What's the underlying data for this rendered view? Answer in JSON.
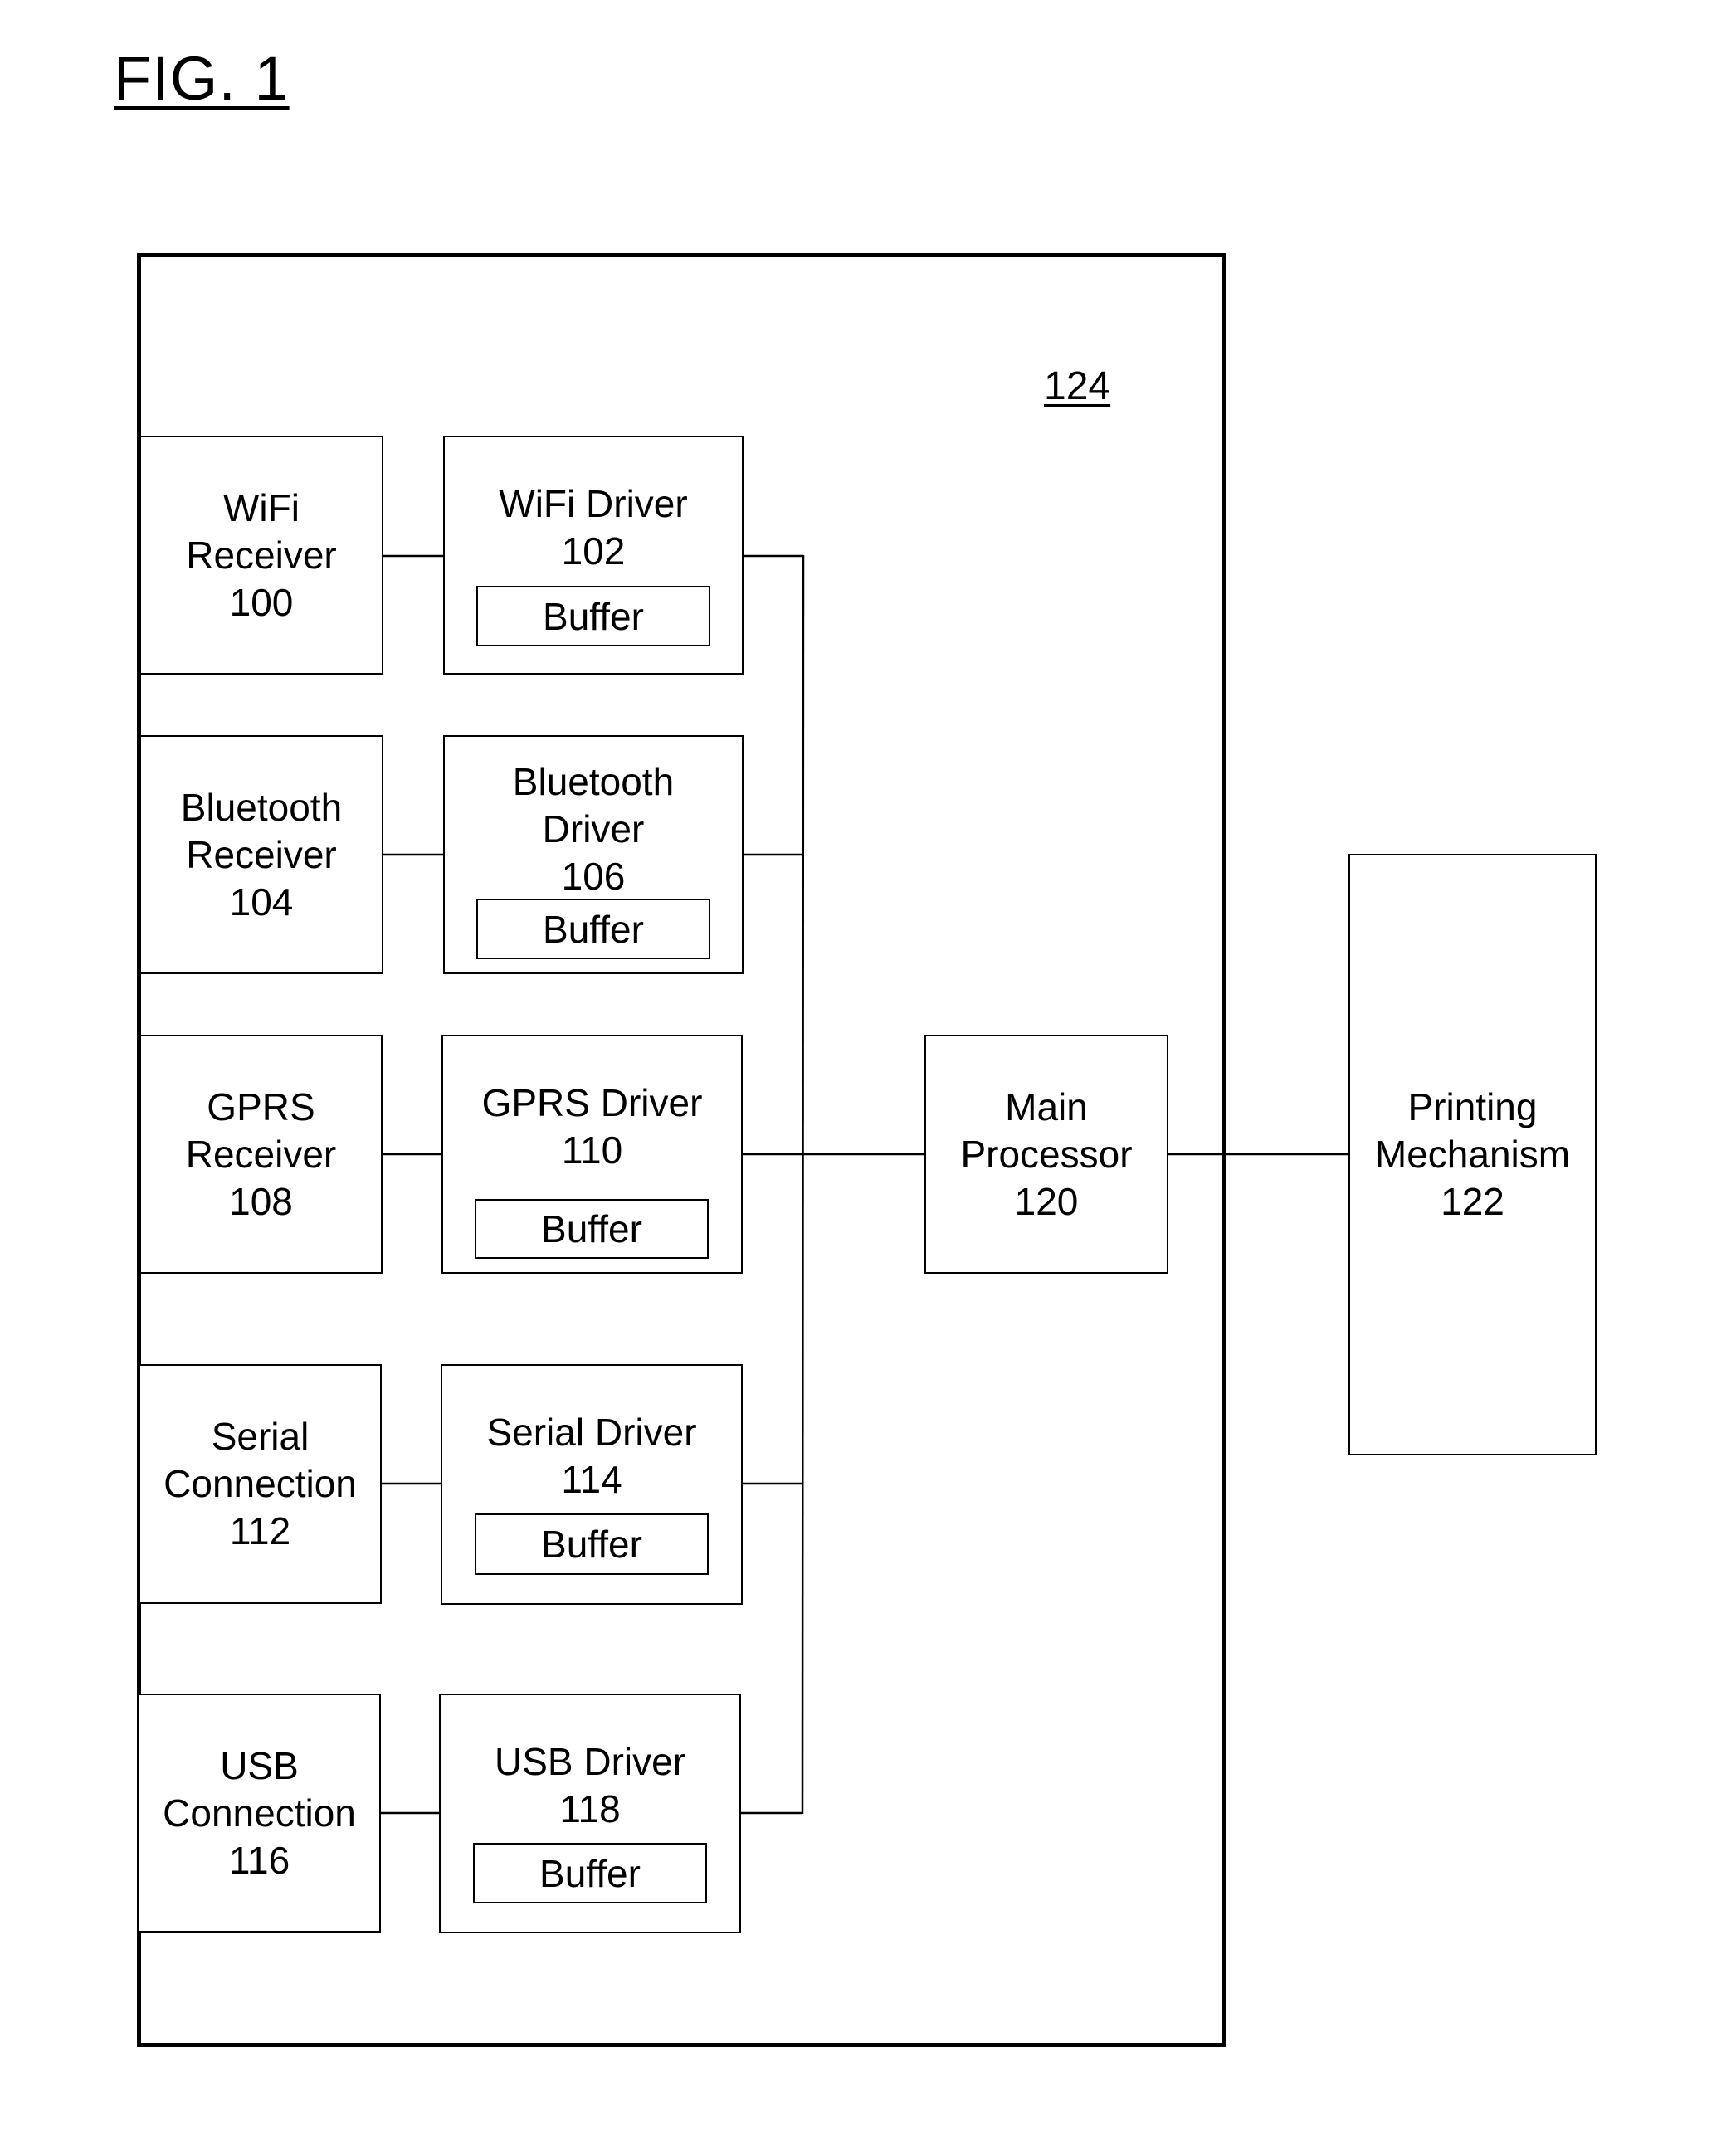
{
  "figure": {
    "title": "FIG. 1",
    "enclosure_ref": "124"
  },
  "receivers": [
    {
      "label": "WiFi\nReceiver\n100"
    },
    {
      "label": "Bluetooth\nReceiver\n104"
    },
    {
      "label": "GPRS\nReceiver\n108"
    },
    {
      "label": "Serial\nConnection\n112"
    },
    {
      "label": "USB\nConnection\n116"
    }
  ],
  "drivers": [
    {
      "label": "WiFi Driver\n102",
      "buffer": "Buffer"
    },
    {
      "label": "Bluetooth\nDriver\n106",
      "buffer": "Buffer"
    },
    {
      "label": "GPRS Driver\n110",
      "buffer": "Buffer"
    },
    {
      "label": "Serial Driver\n114",
      "buffer": "Buffer"
    },
    {
      "label": "USB Driver\n118",
      "buffer": "Buffer"
    }
  ],
  "processor": {
    "label": "Main\nProcessor\n120"
  },
  "printer": {
    "label": "Printing\nMechanism\n122"
  }
}
